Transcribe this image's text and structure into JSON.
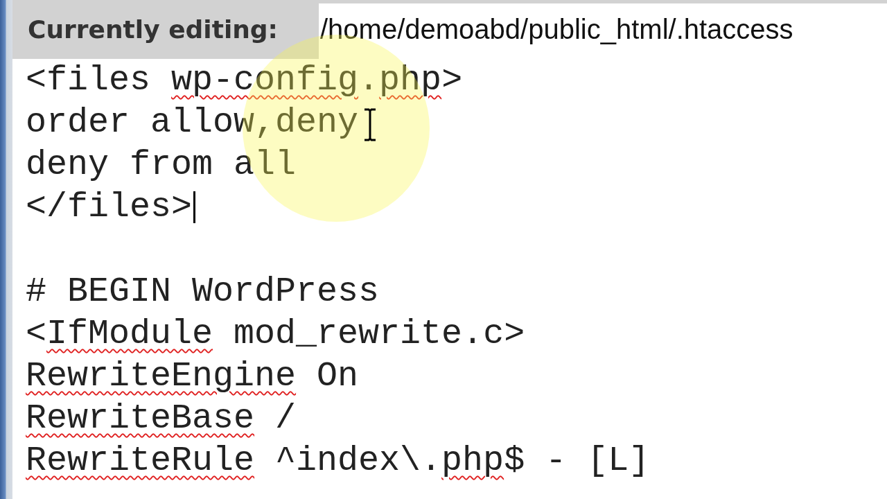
{
  "header": {
    "label": "Currently editing:",
    "path": "/home/demoabd/public_html/.htaccess"
  },
  "lines": [
    {
      "caret": false,
      "segments": [
        {
          "text": "<files ",
          "misspelled": false
        },
        {
          "text": "wp-config",
          "misspelled": true
        },
        {
          "text": ".",
          "misspelled": false
        },
        {
          "text": "php",
          "misspelled": true
        },
        {
          "text": ">",
          "misspelled": false
        }
      ]
    },
    {
      "caret": false,
      "segments": [
        {
          "text": "order allow,deny",
          "misspelled": false
        }
      ]
    },
    {
      "caret": false,
      "segments": [
        {
          "text": "deny from all",
          "misspelled": false
        }
      ]
    },
    {
      "caret": true,
      "segments": [
        {
          "text": "</files>",
          "misspelled": false
        }
      ]
    },
    {
      "caret": false
    },
    {
      "caret": false,
      "segments": [
        {
          "text": "# BEGIN WordPress",
          "misspelled": false
        }
      ]
    },
    {
      "caret": false,
      "segments": [
        {
          "text": "<",
          "misspelled": false
        },
        {
          "text": "IfModule",
          "misspelled": true
        },
        {
          "text": " mod_rewrite.c>",
          "misspelled": false
        }
      ]
    },
    {
      "caret": false,
      "segments": [
        {
          "text": "RewriteEngine",
          "misspelled": true
        },
        {
          "text": " On",
          "misspelled": false
        }
      ]
    },
    {
      "caret": false,
      "segments": [
        {
          "text": "RewriteBase",
          "misspelled": true
        },
        {
          "text": " /",
          "misspelled": false
        }
      ]
    },
    {
      "caret": false,
      "segments": [
        {
          "text": "RewriteRule",
          "misspelled": true
        },
        {
          "text": " ^index\\.",
          "misspelled": false
        },
        {
          "text": "php",
          "misspelled": true
        },
        {
          "text": "$ - [L]",
          "misspelled": false
        }
      ]
    }
  ]
}
